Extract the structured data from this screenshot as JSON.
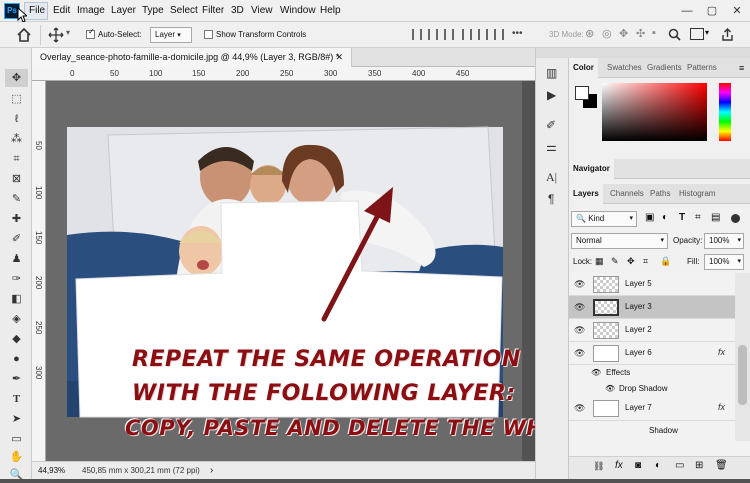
{
  "menubar": {
    "logo": "Ps",
    "items": [
      "File",
      "Edit",
      "Image",
      "Layer",
      "Type",
      "Select",
      "Filter",
      "3D",
      "View",
      "Window",
      "Help"
    ],
    "window_controls": {
      "minimize": "—",
      "maximize": "▢",
      "close": "✕"
    }
  },
  "options": {
    "auto_select_label": "Auto-Select:",
    "auto_select_value": "Layer",
    "transform_label": "Show Transform Controls",
    "mode_label": "3D Mode:"
  },
  "document": {
    "tab_title": "Overlay_seance-photo-famille-a-domicile.jpg @ 44,9% (Layer 3, RGB/8#) *",
    "ruler_h": [
      "0",
      "50",
      "100",
      "150",
      "200",
      "250",
      "300",
      "350",
      "400",
      "450"
    ],
    "ruler_v": [
      "50",
      "100",
      "150",
      "200",
      "250",
      "300"
    ]
  },
  "status": {
    "zoom": "44,93%",
    "dimensions": "450,85 mm x 300,21 mm (72 ppi)"
  },
  "panels": {
    "color_tabs": [
      "Color",
      "Swatches",
      "Gradients",
      "Patterns"
    ],
    "navigator": "Navigator",
    "layer_tabs": [
      "Layers",
      "Channels",
      "Paths",
      "Histogram"
    ],
    "kind": "Kind",
    "blend_mode": "Normal",
    "opacity_label": "Opacity:",
    "opacity_value": "100%",
    "lock_label": "Lock:",
    "fill_label": "Fill:",
    "fill_value": "100%"
  },
  "layers": [
    {
      "name": "Layer 5"
    },
    {
      "name": "Layer 3",
      "active": true
    },
    {
      "name": "Layer 2"
    },
    {
      "name": "Layer 6",
      "fx": "fx",
      "effects_label": "Effects",
      "effect": "Drop Shadow"
    },
    {
      "name": "Layer 7",
      "fx": "fx",
      "effect_partial": "Shadow"
    }
  ],
  "annotation": {
    "line1": "REPEAT THE SAME OPERATION",
    "line2": "WITH THE FOLLOWING LAYER:",
    "line3": "COPY, PASTE AND DELETE THE WHITE FRAME",
    "color": "#8a0e12"
  }
}
